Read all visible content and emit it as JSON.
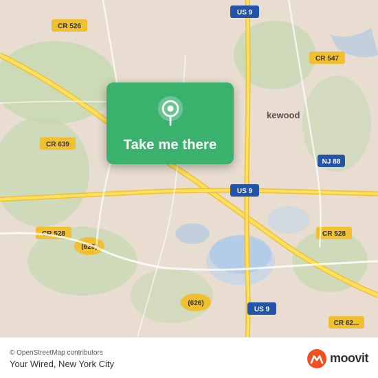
{
  "map": {
    "attribution": "© OpenStreetMap contributors",
    "accent_color": "#3ab26e",
    "road_color_major": "#f5c842",
    "road_color_minor": "#ffffff",
    "background_color": "#e8e0d8",
    "water_color": "#b0cfe0",
    "green_area_color": "#c8dfc0"
  },
  "card": {
    "button_label": "Take me there",
    "pin_icon": "location-pin"
  },
  "bottom_bar": {
    "attribution": "© OpenStreetMap contributors",
    "location_name": "Your Wired, New York City",
    "brand_name": "moovit"
  }
}
